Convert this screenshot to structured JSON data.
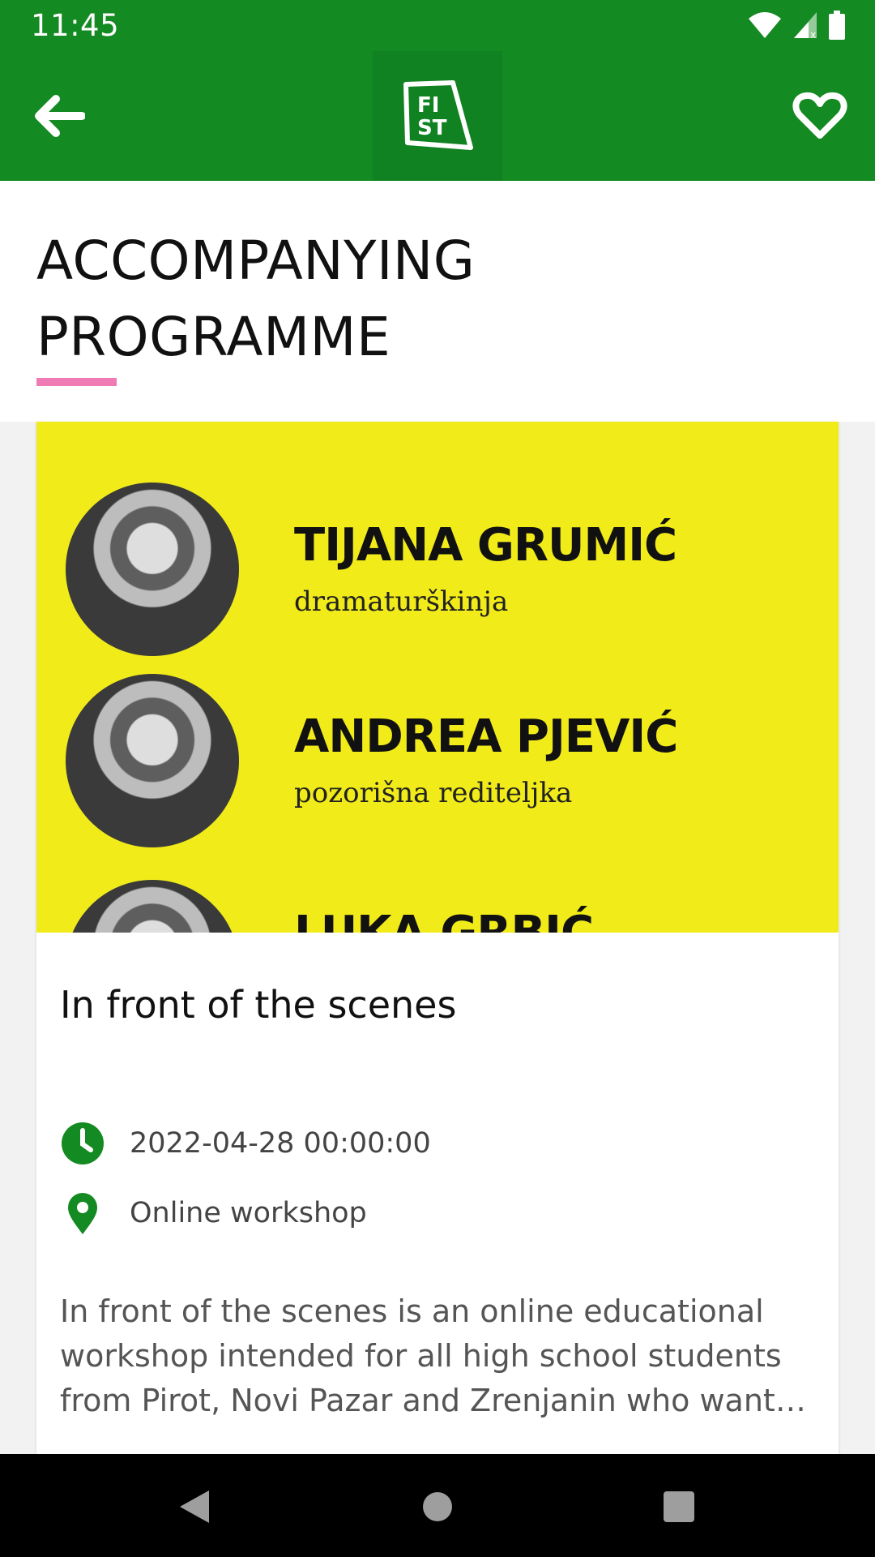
{
  "status_bar": {
    "time": "11:45",
    "icons": [
      "wifi-icon",
      "signal-icon",
      "battery-icon"
    ]
  },
  "app_bar": {
    "back_icon": "arrow-left-icon",
    "logo_text": [
      "FI",
      "ST"
    ],
    "favorite_icon": "heart-outline-icon"
  },
  "header": {
    "title": "ACCOMPANYING PROGRAMME",
    "accent_color": "#f07ab4"
  },
  "banner": {
    "background": "#f1eb1a",
    "people": [
      {
        "name": "TIJANA GRUMIĆ",
        "role": "dramaturškinja"
      },
      {
        "name": "ANDREA PJEVIĆ",
        "role": "pozorišna rediteljka"
      },
      {
        "name": "LUKA GRBIĆ",
        "role": ""
      }
    ]
  },
  "event": {
    "title": "In front of the scenes",
    "datetime": "2022-04-28 00:00:00",
    "location": "Online workshop",
    "description_lines": [
      "In front of the scenes is an online educational",
      "workshop intended for all high school students",
      "from Pirot, Novi Pazar and Zrenjanin who want t..."
    ]
  },
  "colors": {
    "primary": "#148a22",
    "icon": "#148a22"
  },
  "nav": {
    "back": "back-triangle-icon",
    "home": "home-circle-icon",
    "recents": "recents-square-icon"
  }
}
